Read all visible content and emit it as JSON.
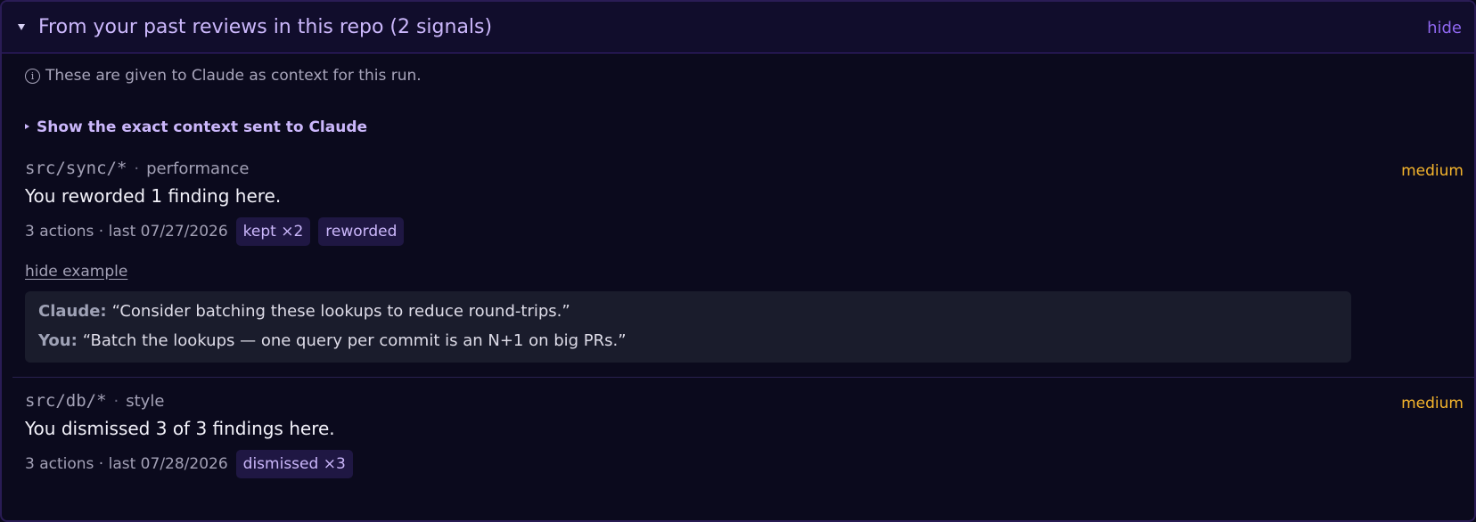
{
  "header": {
    "title": "From your past reviews in this repo (2 signals)",
    "hide_label": "hide"
  },
  "context_note": {
    "icon": "info-icon",
    "text": "These are given to Claude as context for this run."
  },
  "show_context_label": "Show the exact context sent to Claude",
  "colors": {
    "accent": "#cbb7fb",
    "severity_medium": "#f5b52c",
    "background": "#0b0a1d"
  },
  "signals": [
    {
      "path": "src/sync/*",
      "separator": "·",
      "category": "performance",
      "severity": "medium",
      "summary": "You reworded 1 finding here.",
      "meta": "3 actions · last 07/27/2026",
      "tags": [
        "kept ×2",
        "reworded"
      ],
      "hide_example_label": "hide example",
      "example": {
        "claude_label": "Claude:",
        "claude_text": "“Consider batching these lookups to reduce round-trips.”",
        "you_label": "You:",
        "you_text": "“Batch the lookups — one query per commit is an N+1 on big PRs.”"
      }
    },
    {
      "path": "src/db/*",
      "separator": "·",
      "category": "style",
      "severity": "medium",
      "summary": "You dismissed 3 of 3 findings here.",
      "meta": "3 actions · last 07/28/2026",
      "tags": [
        "dismissed ×3"
      ]
    }
  ]
}
